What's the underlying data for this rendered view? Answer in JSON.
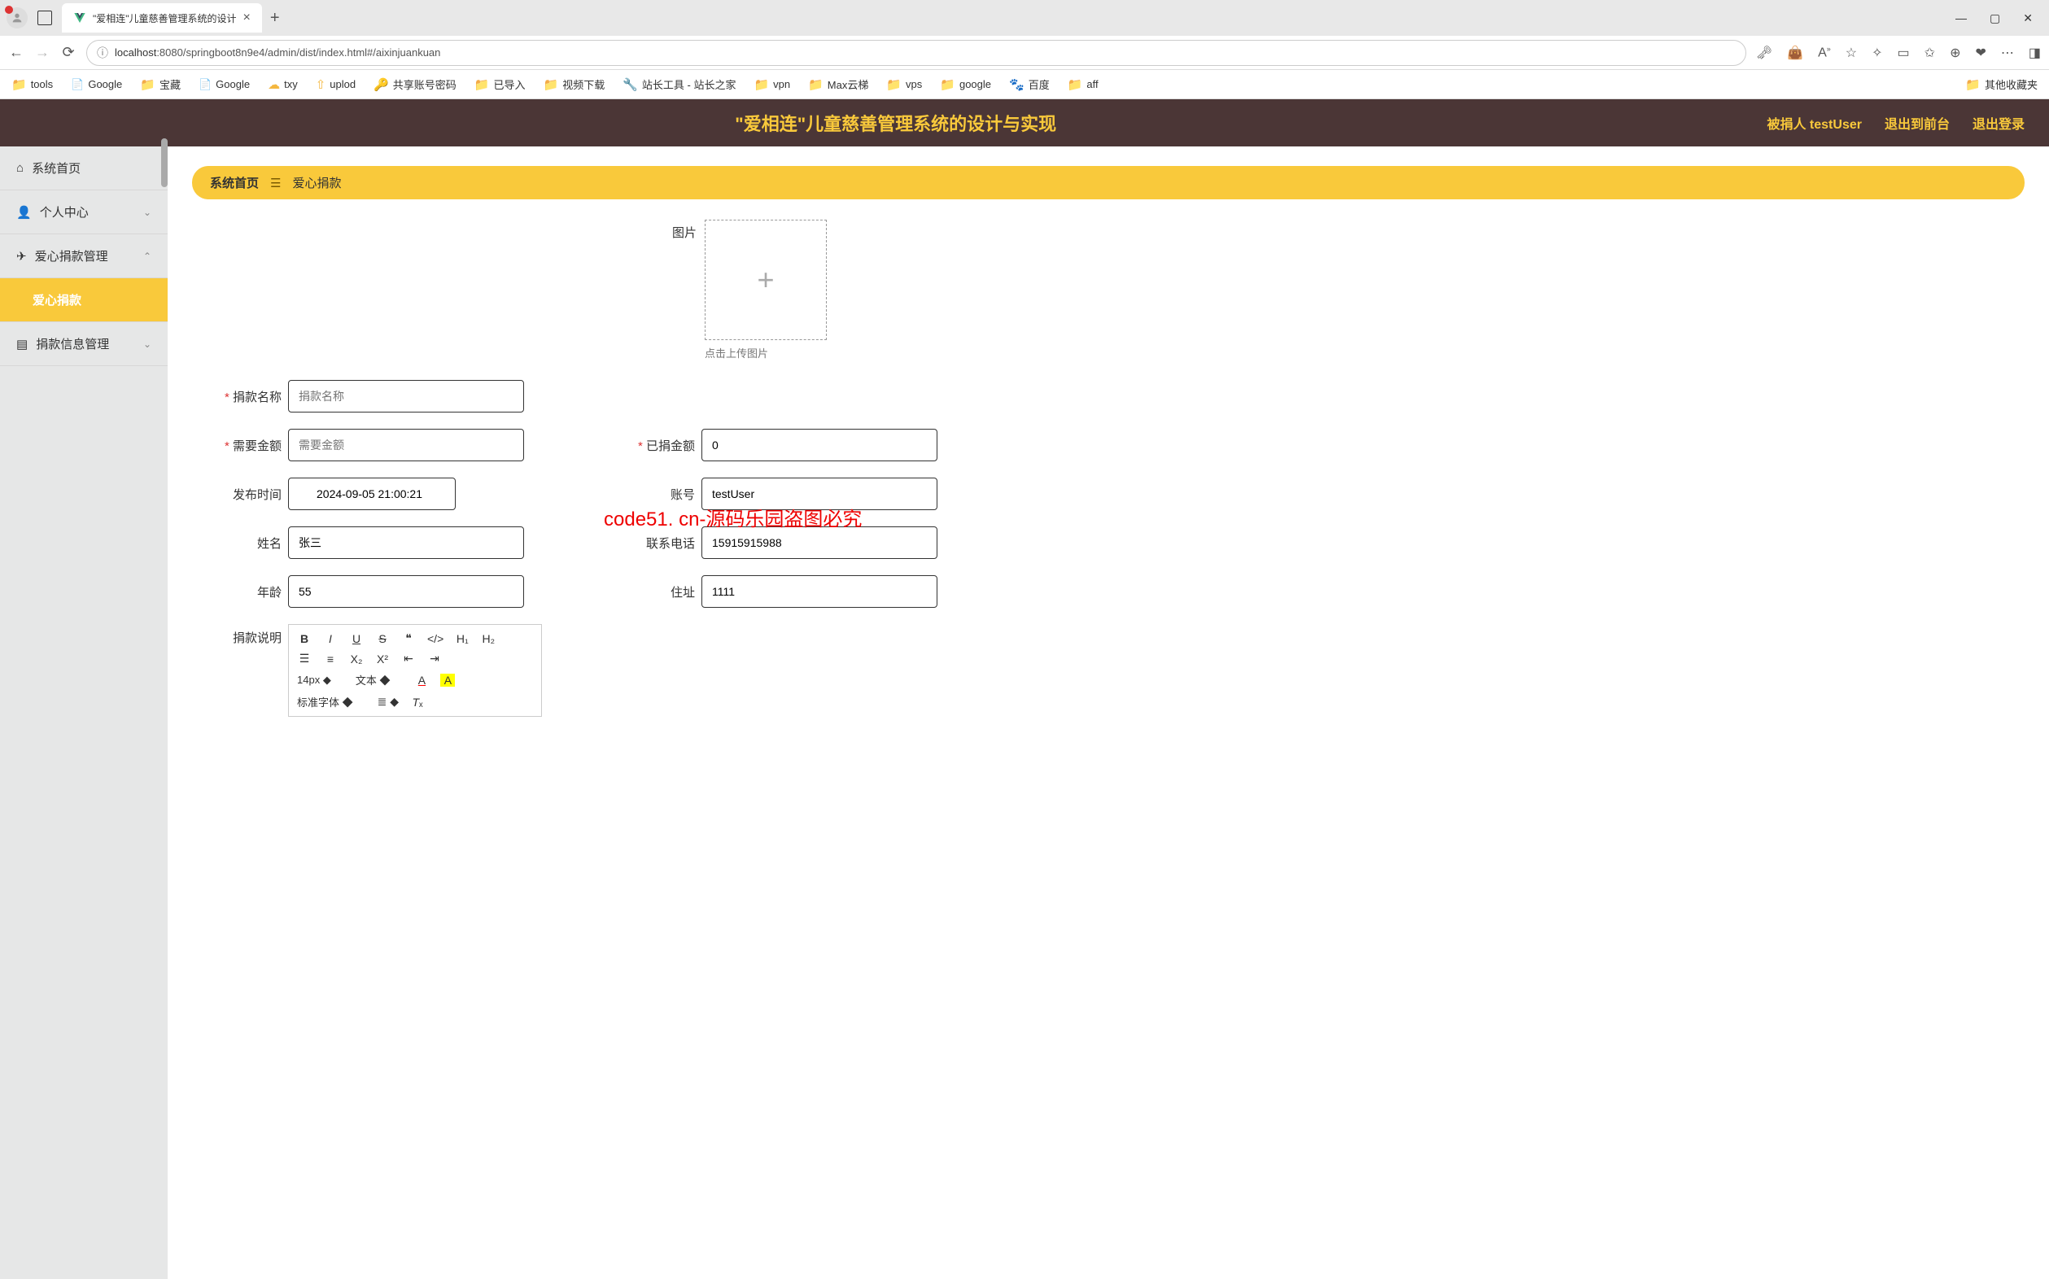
{
  "browser": {
    "tab_title": "\"爱相连\"儿童慈善管理系统的设计",
    "url_host": "localhost",
    "url_path": ":8080/springboot8n9e4/admin/dist/index.html#/aixinjuankuan",
    "bookmarks": [
      "tools",
      "Google",
      "宝藏",
      "Google",
      "txy",
      "uplod",
      "共享账号密码",
      "已导入",
      "视频下载",
      "站长工具 - 站长之家",
      "vpn",
      "Max云梯",
      "vps",
      "google",
      "百度",
      "aff"
    ],
    "bookmarks_right": "其他收藏夹"
  },
  "header": {
    "title": "\"爱相连\"儿童慈善管理系统的设计与实现",
    "user_label": "被捐人 testUser",
    "exit_front": "退出到前台",
    "logout": "退出登录"
  },
  "sidebar": {
    "home": "系统首页",
    "personal": "个人中心",
    "donation_mgmt": "爱心捐款管理",
    "donation": "爱心捐款",
    "donation_info": "捐款信息管理"
  },
  "breadcrumb": {
    "home": "系统首页",
    "page": "爱心捐款"
  },
  "form": {
    "image_label": "图片",
    "upload_hint": "点击上传图片",
    "name_label": "捐款名称",
    "name_placeholder": "捐款名称",
    "need_label": "需要金额",
    "need_placeholder": "需要金额",
    "donated_label": "已捐金额",
    "donated_value": "0",
    "publish_label": "发布时间",
    "publish_value": "2024-09-05 21:00:21",
    "account_label": "账号",
    "account_value": "testUser",
    "realname_label": "姓名",
    "realname_value": "张三",
    "phone_label": "联系电话",
    "phone_value": "15915915988",
    "age_label": "年龄",
    "age_value": "55",
    "address_label": "住址",
    "address_value": "1111",
    "desc_label": "捐款说明"
  },
  "editor": {
    "fontsize": "14px",
    "textmode": "文本",
    "fontfamily": "标准字体"
  },
  "watermark": "code51.cn",
  "watermark_red": "code51. cn-源码乐园盗图必究"
}
